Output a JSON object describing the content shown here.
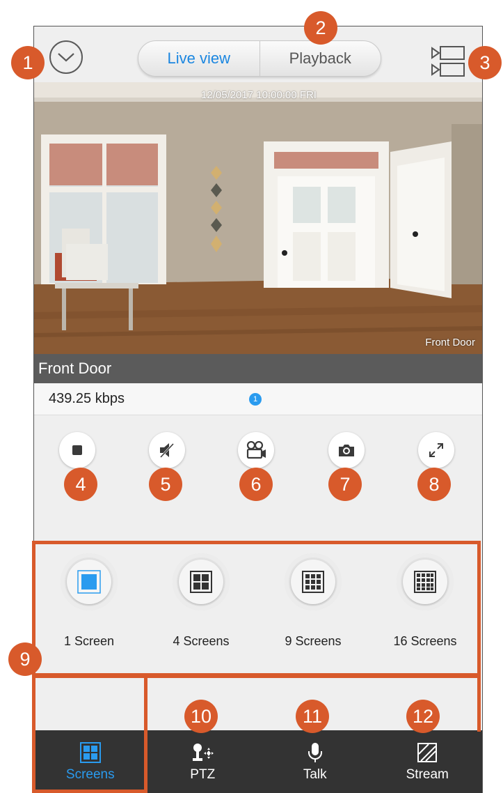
{
  "header": {
    "tabs": [
      {
        "label": "Live view",
        "active": true
      },
      {
        "label": "Playback",
        "active": false
      }
    ],
    "back_icon": "chevron-down-icon",
    "cameras_icon": "camera-list-icon"
  },
  "video": {
    "timestamp": "12/05/2017 10:00:00 FRI",
    "overlay_name": "Front Door"
  },
  "camera": {
    "name": "Front Door",
    "bitrate": "439.25 kbps",
    "channel_badge": "1"
  },
  "controls": [
    {
      "icon": "stop-icon"
    },
    {
      "icon": "mute-icon"
    },
    {
      "icon": "record-icon"
    },
    {
      "icon": "snapshot-icon"
    },
    {
      "icon": "fullscreen-icon"
    }
  ],
  "screens": [
    {
      "label": "1 Screen",
      "grid": 1,
      "selected": true
    },
    {
      "label": "4 Screens",
      "grid": 2,
      "selected": false
    },
    {
      "label": "9 Screens",
      "grid": 3,
      "selected": false
    },
    {
      "label": "16 Screens",
      "grid": 4,
      "selected": false
    }
  ],
  "tabbar": [
    {
      "label": "Screens",
      "icon": "screens-grid-icon",
      "active": true
    },
    {
      "label": "PTZ",
      "icon": "ptz-icon",
      "active": false
    },
    {
      "label": "Talk",
      "icon": "microphone-icon",
      "active": false
    },
    {
      "label": "Stream",
      "icon": "stream-icon",
      "active": false
    }
  ],
  "callouts": [
    "1",
    "2",
    "3",
    "4",
    "5",
    "6",
    "7",
    "8",
    "9",
    "10",
    "11",
    "12"
  ],
  "colors": {
    "accent": "#1a86e0",
    "callout": "#d85a2b",
    "tabbar": "#333333"
  }
}
